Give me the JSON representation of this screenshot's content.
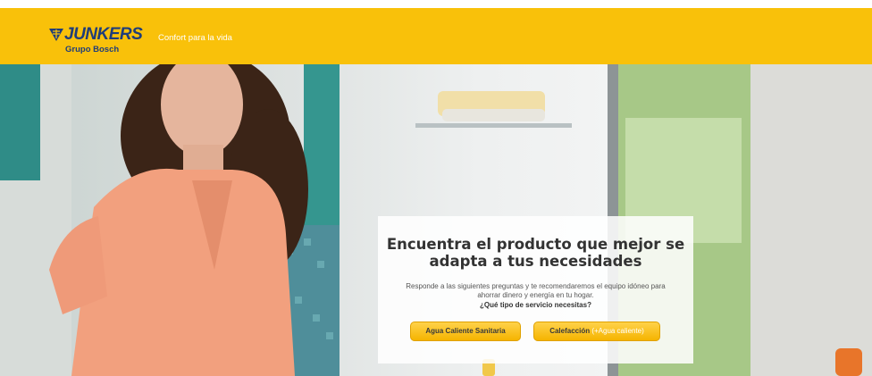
{
  "header": {
    "brand": "JUNKERS",
    "brand_sub": "Grupo Bosch",
    "tagline": "Confort para la vida",
    "color": "#f9c10a"
  },
  "card": {
    "title_line1": "Encuentra el producto que mejor se",
    "title_line2": "adapta a tus necesidades",
    "desc_line1": "Responde a las siguientes preguntas y te recomendaremos el equipo idóneo para",
    "desc_line2": "ahorrar dinero y energía en tu hogar.",
    "question": "¿Qué tipo de servicio necesitas?",
    "button_hot_water": "Agua Caliente Sanitaria",
    "button_heating": "Calefacción",
    "button_heating_extra": " (+Agua caliente)"
  },
  "colors": {
    "button": "#f5b400",
    "brand_blue": "#1f3d7a"
  }
}
